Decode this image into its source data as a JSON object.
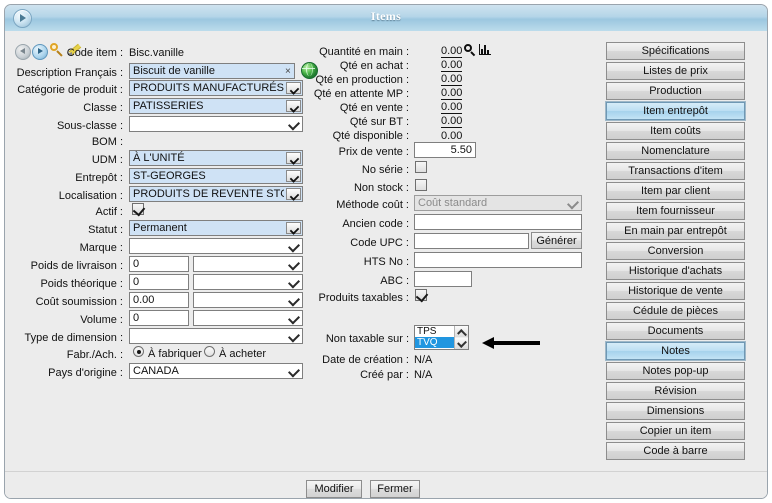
{
  "window": {
    "title": "Items"
  },
  "toolbar": {
    "back_icon": "arrow-left-circle-icon",
    "forward_icon": "arrow-right-circle-icon",
    "search_icon": "magnifier-icon",
    "edit_icon": "pencil-icon"
  },
  "left_form": {
    "code_item": {
      "label": "Code item :",
      "value": "Bisc.vanille"
    },
    "description_fr": {
      "label": "Description Français :",
      "value": "Biscuit de vanille",
      "clear": "×",
      "globe_icon": "globe-icon"
    },
    "categorie_produit": {
      "label": "Catégorie de produit :",
      "value": "PRODUITS MANUFACTURÉS"
    },
    "classe": {
      "label": "Classe :",
      "value": "PATISSERIES"
    },
    "sous_classe": {
      "label": "Sous-classe :",
      "value": ""
    },
    "bom": {
      "label": "BOM :",
      "value": ""
    },
    "udm": {
      "label": "UDM :",
      "value": "À L'UNITÉ"
    },
    "entrepot": {
      "label": "Entrepôt :",
      "value": "ST-GEORGES"
    },
    "localisation": {
      "label": "Localisation  :",
      "value": "PRODUITS DE REVENTE STG"
    },
    "actif": {
      "label": "Actif :",
      "checked": true
    },
    "statut": {
      "label": "Statut :",
      "value": "Permanent"
    },
    "marque": {
      "label": "Marque :",
      "value": ""
    },
    "poids_livraison": {
      "label": "Poids de livraison :",
      "value": "0",
      "unit": ""
    },
    "poids_theorique": {
      "label": "Poids théorique :",
      "value": "0",
      "unit": ""
    },
    "cout_soumission": {
      "label": "Coût soumission :",
      "value": "0.00",
      "unit": ""
    },
    "volume": {
      "label": "Volume :",
      "value": "0",
      "unit": ""
    },
    "type_dimension": {
      "label": "Type de dimension :",
      "value": ""
    },
    "fabr_ach": {
      "label": "Fabr./Ach. :",
      "options": [
        "À fabriquer",
        "À acheter"
      ],
      "selected": "À fabriquer"
    },
    "pays_origine": {
      "label": "Pays d'origine :",
      "value": "CANADA"
    }
  },
  "mid_form": {
    "quantite_main": {
      "label": "Quantité en main :",
      "value": "0.00",
      "search_icon": "magnifier-icon",
      "chart_icon": "bar-chart-icon"
    },
    "qte_achat": {
      "label": "Qté en achat :",
      "value": "0.00"
    },
    "qte_production": {
      "label": "Qté en production :",
      "value": "0.00"
    },
    "qte_attente_mp": {
      "label": "Qté en attente MP :",
      "value": "0.00"
    },
    "qte_vente": {
      "label": "Qté en vente :",
      "value": "0.00"
    },
    "qte_bt": {
      "label": "Qté sur BT :",
      "value": "0.00"
    },
    "qte_disponible": {
      "label": "Qté disponible :",
      "value": "0.00"
    },
    "prix_vente": {
      "label": "Prix de vente :",
      "value": "5.50"
    },
    "no_serie": {
      "label": "No série :",
      "checked": false
    },
    "non_stock": {
      "label": "Non stock :",
      "checked": false
    },
    "methode_cout": {
      "label": "Méthode coût :",
      "value": "Coût standard"
    },
    "ancien_code": {
      "label": "Ancien code :",
      "value": ""
    },
    "code_upc": {
      "label": "Code UPC :",
      "value": "",
      "button": "Générer"
    },
    "hts_no": {
      "label": "HTS No :",
      "value": ""
    },
    "abc": {
      "label": "ABC :",
      "value": ""
    },
    "produits_taxables": {
      "label": "Produits taxables :",
      "checked": true
    },
    "non_taxable_sur": {
      "label": "Non taxable sur :",
      "options": [
        "TPS",
        "TVQ"
      ],
      "selected": "TVQ"
    },
    "date_creation": {
      "label": "Date de création :",
      "value": "N/A"
    },
    "cree_par": {
      "label": "Créé par :",
      "value": "N/A"
    }
  },
  "sidebar": {
    "buttons": [
      {
        "label": "Spécifications",
        "active": false
      },
      {
        "label": "Listes de prix",
        "active": false
      },
      {
        "label": "Production",
        "active": false
      },
      {
        "label": "Item entrepôt",
        "active": true
      },
      {
        "label": "Item coûts",
        "active": false
      },
      {
        "label": "Nomenclature",
        "active": false
      },
      {
        "label": "Transactions d'item",
        "active": false
      },
      {
        "label": "Item par client",
        "active": false
      },
      {
        "label": "Item fournisseur",
        "active": false
      },
      {
        "label": "En main par entrepôt",
        "active": false
      },
      {
        "label": "Conversion",
        "active": false
      },
      {
        "label": "Historique d'achats",
        "active": false
      },
      {
        "label": "Historique de vente",
        "active": false
      },
      {
        "label": "Cédule de pièces",
        "active": false
      },
      {
        "label": "Documents",
        "active": false
      },
      {
        "label": "Notes",
        "active": true
      },
      {
        "label": "Notes pop-up",
        "active": false
      },
      {
        "label": "Révision",
        "active": false
      },
      {
        "label": "Dimensions",
        "active": false
      },
      {
        "label": "Copier un item",
        "active": false
      },
      {
        "label": "Code à barre",
        "active": false
      }
    ]
  },
  "footer": {
    "modifier": "Modifier",
    "fermer": "Fermer"
  },
  "colors": {
    "title_bar": "#9cc7e0",
    "filled_field": "#cfe2f5",
    "selected_option": "#2196e0",
    "active_button": "#a5d2ec",
    "panel_bg": "#ececec"
  }
}
